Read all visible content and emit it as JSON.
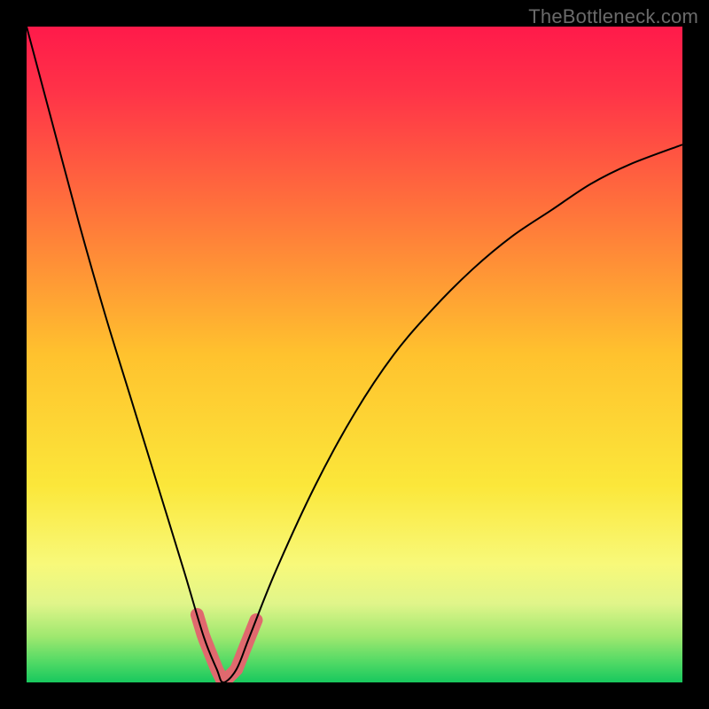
{
  "watermark": "TheBottleneck.com",
  "chart_data": {
    "type": "line",
    "title": "",
    "xlabel": "",
    "ylabel": "",
    "xlim": [
      0,
      100
    ],
    "ylim": [
      0,
      100
    ],
    "x": [
      0,
      4,
      8,
      12,
      16,
      20,
      24,
      27,
      29,
      30,
      32,
      34,
      38,
      44,
      50,
      56,
      62,
      68,
      74,
      80,
      86,
      92,
      100
    ],
    "y": [
      100,
      85,
      70,
      56,
      43,
      30,
      17,
      7,
      2,
      0,
      2,
      7,
      17,
      30,
      41,
      50,
      57,
      63,
      68,
      72,
      76,
      79,
      82
    ],
    "highlight_region": {
      "x_range": [
        26,
        35
      ],
      "note": "thick salmon marker strip near curve bottom"
    },
    "background_gradient": {
      "stops": [
        {
          "offset": 0.0,
          "color": "#ff1a4a"
        },
        {
          "offset": 0.1,
          "color": "#ff3348"
        },
        {
          "offset": 0.3,
          "color": "#ff7a3a"
        },
        {
          "offset": 0.5,
          "color": "#ffc22e"
        },
        {
          "offset": 0.7,
          "color": "#fbe73a"
        },
        {
          "offset": 0.82,
          "color": "#f8f97a"
        },
        {
          "offset": 0.88,
          "color": "#e0f58a"
        },
        {
          "offset": 0.93,
          "color": "#9fe86f"
        },
        {
          "offset": 0.97,
          "color": "#4fd965"
        },
        {
          "offset": 1.0,
          "color": "#18c85e"
        }
      ]
    },
    "highlight_color": "#e0696e",
    "curve_color": "#000000"
  }
}
